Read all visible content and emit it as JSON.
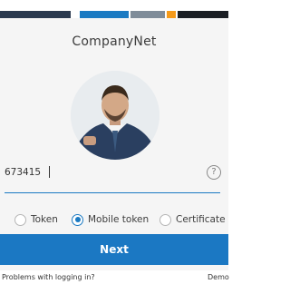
{
  "colors": {
    "accent": "#1b78c3",
    "top_segments": [
      "#2b3a4f",
      "#1b7ac2",
      "#7f8c99",
      "#f59a1a",
      "#1b1f24"
    ]
  },
  "app_title": "CompanyNet",
  "login": {
    "code_value": "673415",
    "help_symbol": "?",
    "options": [
      {
        "label": "Token",
        "selected": false
      },
      {
        "label": "Mobile token",
        "selected": true
      },
      {
        "label": "Certificate",
        "selected": false
      }
    ],
    "submit_label": "Next"
  },
  "footer": {
    "problems_link": "Problems with logging in?",
    "demo_link": "Demo"
  }
}
